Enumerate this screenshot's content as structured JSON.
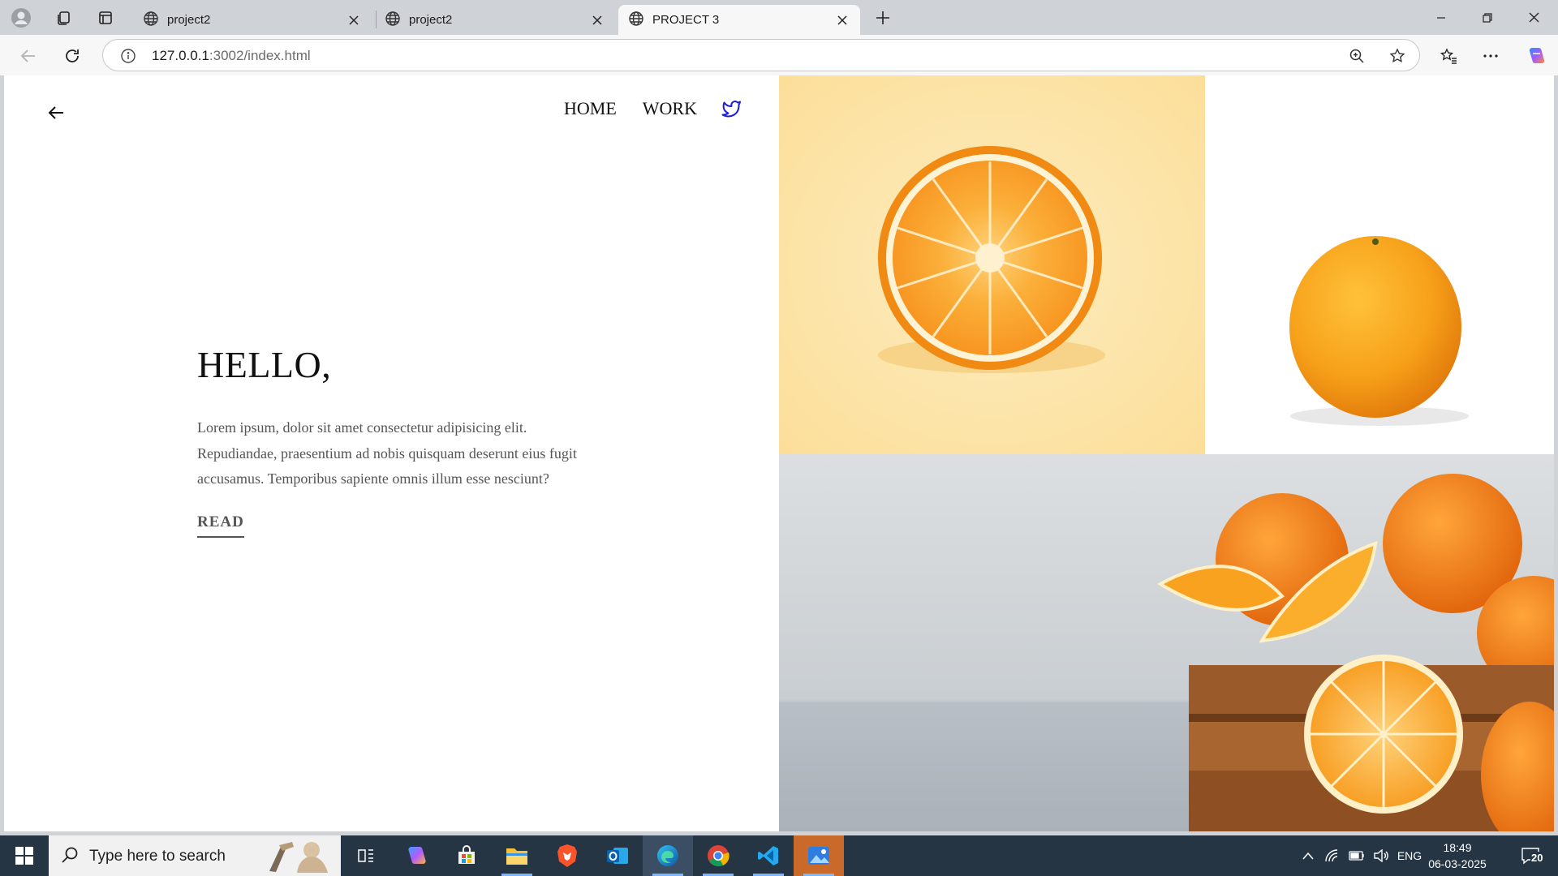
{
  "browser": {
    "tabs": [
      {
        "title": "project2",
        "active": false
      },
      {
        "title": "project2",
        "active": false
      },
      {
        "title": "PROJECT 3",
        "active": true
      }
    ],
    "address": {
      "host": "127.0.0.1",
      "path": ":3002/index.html"
    }
  },
  "page": {
    "nav": {
      "home": "HOME",
      "work": "WORK",
      "social_icon": "twitter-icon"
    },
    "hero": {
      "heading": "HELLO,",
      "body": "Lorem ipsum, dolor sit amet consectetur adipisicing elit. Repudiandae, praesentium ad nobis quisquam deserunt eius fugit accusamus. Temporibus sapiente omnis illum esse nesciunt?",
      "cta": "READ"
    },
    "images": [
      {
        "subject": "orange half on yellow background"
      },
      {
        "subject": "whole orange on white background"
      },
      {
        "subject": "oranges in wooden crate on grey marble"
      }
    ]
  },
  "taskbar": {
    "search_placeholder": "Type here to search",
    "tray": {
      "language": "ENG",
      "notifications": "20"
    },
    "clock": {
      "time": "18:49",
      "date": "06-03-2025"
    }
  },
  "colors": {
    "accent_link": "#1d1dd6",
    "text_gray": "#555555",
    "orange": "#f7931e"
  }
}
